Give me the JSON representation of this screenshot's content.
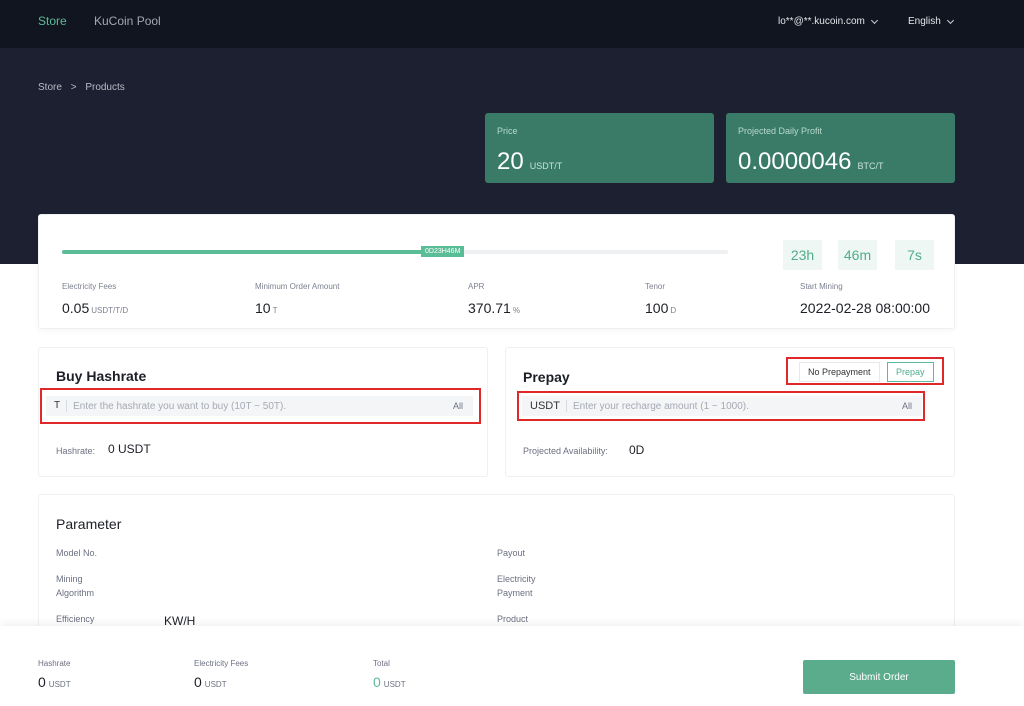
{
  "nav": {
    "store": "Store",
    "pool": "KuCoin Pool",
    "account": "lo**@**.kucoin.com",
    "language": "English"
  },
  "breadcrumb": {
    "root": "Store",
    "sep": ">",
    "current": "Products"
  },
  "stats": {
    "price": {
      "label": "Price",
      "value": "20",
      "unit": "USDT/T"
    },
    "profit": {
      "label": "Projected Daily Profit",
      "value": "0.0000046",
      "unit": "BTC/T"
    }
  },
  "progress": {
    "badge": "0D23H46M",
    "fraction": 0.55,
    "timers": [
      "23h",
      "46m",
      "7s"
    ],
    "metrics": [
      {
        "label": "Electricity Fees",
        "value": "0.05",
        "unit": "USDT/T/D"
      },
      {
        "label": "Minimum Order Amount",
        "value": "10",
        "unit": "T"
      },
      {
        "label": "APR",
        "value": "370.71",
        "unit": "%"
      },
      {
        "label": "Tenor",
        "value": "100",
        "unit": "D"
      },
      {
        "label": "Start Mining",
        "value": "2022-02-28 08:00:00",
        "unit": ""
      }
    ]
  },
  "buy": {
    "title": "Buy Hashrate",
    "prefix": "T",
    "placeholder": "Enter the hashrate you want to buy (10T ~ 50T).",
    "all": "All",
    "summary_label": "Hashrate:",
    "summary_value": "0 USDT"
  },
  "prepay": {
    "title": "Prepay",
    "toggle_off": "No Prepayment",
    "toggle_on": "Prepay",
    "prefix": "USDT",
    "placeholder": "Enter your recharge amount (1 ~ 1000).",
    "all": "All",
    "summary_label": "Projected Availability:",
    "summary_value": "0D"
  },
  "parameter": {
    "title": "Parameter",
    "left": [
      "Model No.",
      "Mining\nAlgorithm",
      "Efficiency"
    ],
    "efficiency_unit": "KW/H",
    "right": [
      "Payout",
      "Electricity\nPayment",
      "Product"
    ]
  },
  "bottom": {
    "hashrate": {
      "label": "Hashrate",
      "value": "0",
      "unit": "USDT"
    },
    "fees": {
      "label": "Electricity Fees",
      "value": "0",
      "unit": "USDT"
    },
    "total": {
      "label": "Total",
      "value": "0",
      "unit": "USDT"
    },
    "submit": "Submit Order"
  },
  "colors": {
    "accent": "#5bbc98",
    "header": "#11151f",
    "hero": "#1c2030",
    "card": "#3a7b67",
    "highlight": "#e02828"
  }
}
